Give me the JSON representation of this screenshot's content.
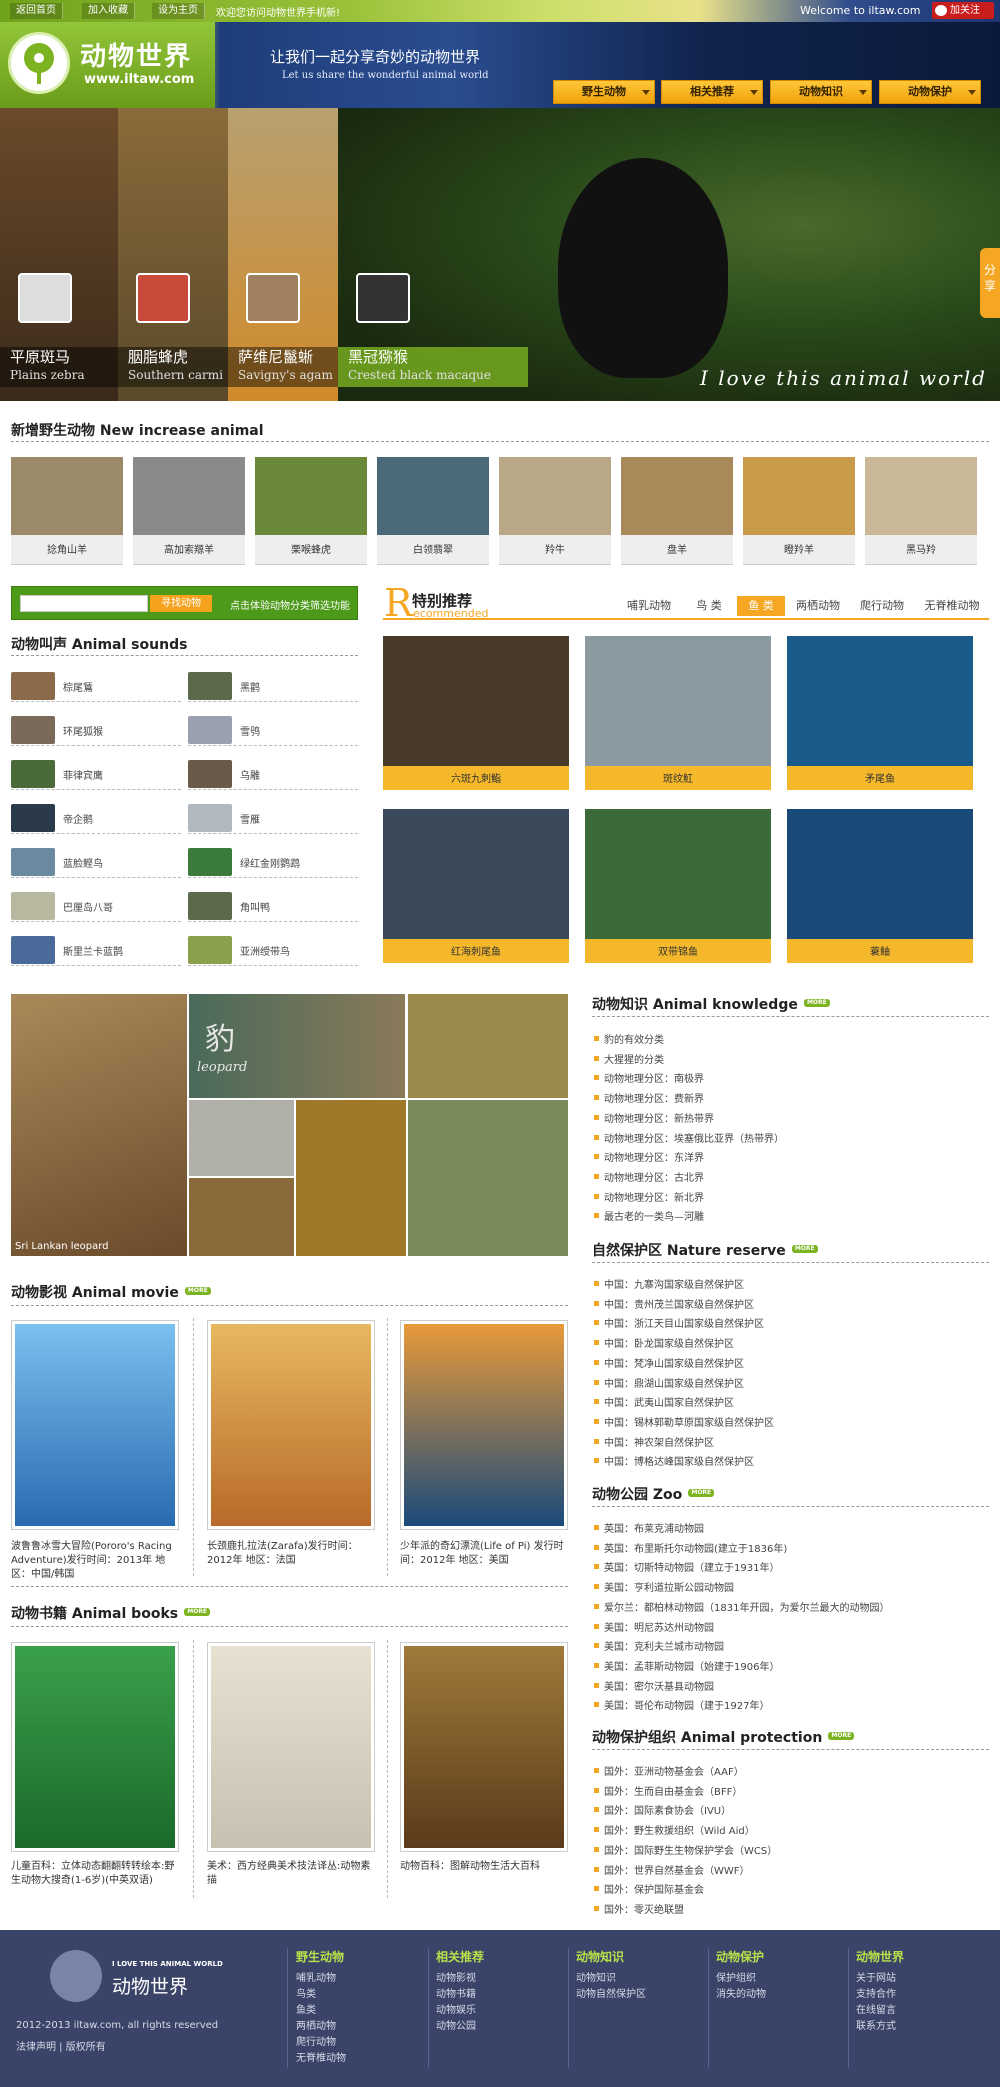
{
  "topbar": {
    "links": [
      "返回首页",
      "加入收藏",
      "设为主页"
    ],
    "welcome_cn": "欢迎您访问动物世界手机新!",
    "welcome_en": "Welcome to iltaw.com",
    "weibo": "加关注"
  },
  "header": {
    "logo_cn": "动物世界",
    "logo_url": "www.iltaw.com",
    "slogan_cn": "让我们一起分享奇妙的动物世界",
    "slogan_en": "Let us share the wonderful animal world",
    "nav": [
      "野生动物",
      "相关推荐",
      "动物知识",
      "动物保护"
    ]
  },
  "banner": {
    "items": [
      {
        "cn": "平原斑马",
        "en": "Plains zebra",
        "color": "#6a4a2a"
      },
      {
        "cn": "胭脂蜂虎",
        "en": "Southern carmi",
        "color": "#8a6a3a"
      },
      {
        "cn": "萨维尼鬣蜥",
        "en": "Savigny's agam",
        "color": "#c48a3a"
      },
      {
        "cn": "黑冠猕猴",
        "en": "Crested black macaque",
        "color": "#7cb320"
      }
    ],
    "motto": "I love this animal world",
    "share": "分享"
  },
  "new_animals": {
    "title": "新增野生动物 New increase animal",
    "items": [
      {
        "name": "捻角山羊",
        "color": "#9b8a6a"
      },
      {
        "name": "高加索羱羊",
        "color": "#8a8a8a"
      },
      {
        "name": "栗喉蜂虎",
        "color": "#6a8a3a"
      },
      {
        "name": "白领翡翠",
        "color": "#4a6a7a"
      },
      {
        "name": "羚牛",
        "color": "#b8a888"
      },
      {
        "name": "盘羊",
        "color": "#a88a5a"
      },
      {
        "name": "瞪羚羊",
        "color": "#c89a4a"
      },
      {
        "name": "黑马羚",
        "color": "#c8b898"
      }
    ]
  },
  "search": {
    "placeholder": "",
    "button": "寻找动物",
    "tip": "点击体验动物分类筛选功能"
  },
  "sounds": {
    "title": "动物叫声 Animal sounds",
    "items": [
      {
        "name": "棕尾鵟",
        "color": "#8a6a4a"
      },
      {
        "name": "黑鹳",
        "color": "#5a6a4a"
      },
      {
        "name": "环尾狐猴",
        "color": "#7a6a5a"
      },
      {
        "name": "雪鸮",
        "color": "#9aa0b0"
      },
      {
        "name": "菲律宾鹰",
        "color": "#4a6a3a"
      },
      {
        "name": "乌雕",
        "color": "#6a5a4a"
      },
      {
        "name": "帝企鹅",
        "color": "#2a3a4a"
      },
      {
        "name": "雪雁",
        "color": "#b0b8c0"
      },
      {
        "name": "蓝脸鲣鸟",
        "color": "#6a8aa0"
      },
      {
        "name": "绿红金刚鹦鹉",
        "color": "#3a7a3a"
      },
      {
        "name": "巴厘岛八哥",
        "color": "#b8b8a0"
      },
      {
        "name": "角叫鸭",
        "color": "#5a6a4a"
      },
      {
        "name": "斯里兰卡蓝鹊",
        "color": "#4a6a9a"
      },
      {
        "name": "亚洲绶带鸟",
        "color": "#8aa04a"
      }
    ]
  },
  "special": {
    "letter": "R",
    "title": "特别推荐",
    "subtitle": "ecommended",
    "tabs": [
      "哺乳动物",
      "鸟 类",
      "鱼 类",
      "两栖动物",
      "爬行动物",
      "无脊椎动物"
    ],
    "active_tab": 2,
    "items": [
      {
        "name": "六斑九刺鮨",
        "color": "#4a3a2a"
      },
      {
        "name": "斑纹魟",
        "color": "#8a9aa0"
      },
      {
        "name": "矛尾鱼",
        "color": "#1a5a8a"
      },
      {
        "name": "红海刺尾鱼",
        "color": "#3a4a5a"
      },
      {
        "name": "双带锦鱼",
        "color": "#3a6a3a"
      },
      {
        "name": "蓑鲉",
        "color": "#1a4a7a"
      }
    ]
  },
  "gallery": {
    "caption": "Sri Lankan leopard",
    "leopard_cn": "豹",
    "leopard_en": "leopard"
  },
  "knowledge": {
    "title": "动物知识 Animal knowledge",
    "more": "MORE",
    "items": [
      "豹的有效分类",
      "大猩猩的分类",
      "动物地理分区：南极界",
      "动物地理分区：费新界",
      "动物地理分区：新热带界",
      "动物地理分区：埃塞俄比亚界（热带界）",
      "动物地理分区：东洋界",
      "动物地理分区：古北界",
      "动物地理分区：新北界",
      "最古老的一类鸟—河雕"
    ]
  },
  "reserve": {
    "title": "自然保护区 Nature reserve",
    "items": [
      "中国：九寨沟国家级自然保护区",
      "中国：贵州茂兰国家级自然保护区",
      "中国：浙江天目山国家级自然保护区",
      "中国：卧龙国家级自然保护区",
      "中国：梵净山国家级自然保护区",
      "中国：鼎湖山国家级自然保护区",
      "中国：武夷山国家自然保护区",
      "中国：锡林郭勒草原国家级自然保护区",
      "中国：神农架自然保护区",
      "中国：博格达峰国家级自然保护区"
    ]
  },
  "zoo": {
    "title": "动物公园 Zoo",
    "items": [
      "英国：布莱克浦动物园",
      "英国：布里斯托尔动物园(建立于1836年)",
      "英国：切斯特动物园（建立于1931年）",
      "美国：亨利道拉斯公园动物园",
      "爱尔兰：都柏林动物园（1831年开园，为爱尔兰最大的动物园）",
      "美国：明尼苏达州动物园",
      "美国：克利夫兰城市动物园",
      "美国：孟菲斯动物园（始建于1906年）",
      "美国：密尔沃基县动物园",
      "美国：哥伦布动物园（建于1927年）"
    ]
  },
  "protection": {
    "title": "动物保护组织 Animal protection",
    "items": [
      "国外：亚洲动物基金会（AAF）",
      "国外：生而自由基金会（BFF）",
      "国外：国际素食协会（IVU）",
      "国外：野生救援组织（Wild Aid）",
      "国外：国际野生生物保护学会（WCS）",
      "国外：世界自然基金会（WWF）",
      "国外：保护国际基金会",
      "国外：零灭绝联盟"
    ]
  },
  "movies": {
    "title": "动物影视 Animal movie",
    "items": [
      {
        "poster": "波鲁鲁冰雪大冒险",
        "caption": "波鲁鲁冰雪大冒险(Pororo's Racing Adventure)发行时间：2013年 地区：中国/韩国",
        "color": "#3a8ac8"
      },
      {
        "poster": "Zarafa",
        "caption": "长颈鹿扎拉法(Zarafa)发行时间：2012年 地区：法国",
        "color": "#c88a3a"
      },
      {
        "poster": "少年派的奇幻漂流",
        "caption": "少年派的奇幻漂流(Life of Pi) 发行时间：2012年 地区：美国",
        "color": "#1a4a7a"
      }
    ]
  },
  "books": {
    "title": "动物书籍 Animal books",
    "items": [
      {
        "poster": "野生动物大搜奇",
        "caption": "儿童百科：立体动态翻翻转转绘本:野生动物大搜奇(1-6岁)(中英双语)",
        "color": "#2a8a3a"
      },
      {
        "poster": "动物素描",
        "caption": "美术：西方经典美术技法译丛:动物素描",
        "color": "#d8d0c0"
      },
      {
        "poster": "图解动物生活大百科",
        "caption": "动物百科：图解动物生活大百科",
        "color": "#7a5a2a"
      }
    ]
  },
  "footer": {
    "logo_en": "I LOVE THIS ANIMAL WORLD",
    "logo_cn": "动物世界",
    "copyright": "2012-2013 iltaw.com, all rights reserved",
    "legal": "法律声明 | 版权所有",
    "cols": [
      {
        "head": "野生动物",
        "items": [
          "哺乳动物",
          "鸟类",
          "鱼类",
          "两栖动物",
          "爬行动物",
          "无脊椎动物"
        ]
      },
      {
        "head": "相关推荐",
        "items": [
          "动物影视",
          "动物书籍",
          "动物娱乐",
          "动物公园"
        ]
      },
      {
        "head": "动物知识",
        "items": [
          "动物知识",
          "动物自然保护区"
        ]
      },
      {
        "head": "动物保护",
        "items": [
          "保护组织",
          "消失的动物"
        ]
      },
      {
        "head": "动物世界",
        "items": [
          "关于网站",
          "支持合作",
          "在线留言",
          "联系方式"
        ]
      }
    ]
  }
}
